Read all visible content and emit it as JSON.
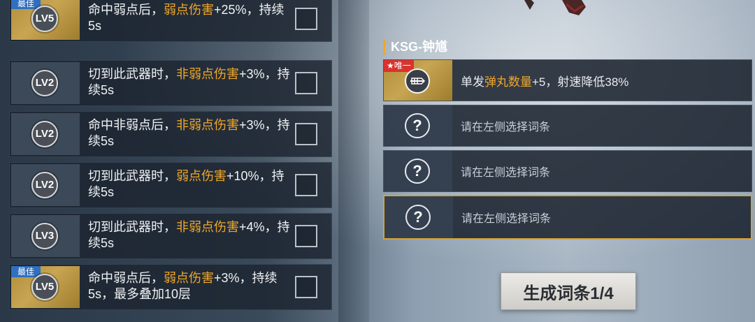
{
  "left_list": [
    {
      "level": "LV5",
      "best": true,
      "best_label": "最佳",
      "text_parts": [
        {
          "t": "命中弱点后，",
          "hl": false
        },
        {
          "t": "弱点伤害",
          "hl": true
        },
        {
          "t": "+25%，持续5s",
          "hl": false
        }
      ]
    },
    {
      "level": "LV2",
      "best": false,
      "best_label": "",
      "text_parts": [
        {
          "t": "切到此武器时，",
          "hl": false
        },
        {
          "t": "非弱点伤害",
          "hl": true
        },
        {
          "t": "+3%，持续5s",
          "hl": false
        }
      ]
    },
    {
      "level": "LV2",
      "best": false,
      "best_label": "",
      "text_parts": [
        {
          "t": "命中非弱点后，",
          "hl": false
        },
        {
          "t": "非弱点伤害",
          "hl": true
        },
        {
          "t": "+3%，持续5s",
          "hl": false
        }
      ]
    },
    {
      "level": "LV2",
      "best": false,
      "best_label": "",
      "text_parts": [
        {
          "t": "切到此武器时，",
          "hl": false
        },
        {
          "t": "弱点伤害",
          "hl": true
        },
        {
          "t": "+10%，持续5s",
          "hl": false
        }
      ]
    },
    {
      "level": "LV3",
      "best": false,
      "best_label": "",
      "text_parts": [
        {
          "t": "切到此武器时，",
          "hl": false
        },
        {
          "t": "非弱点伤害",
          "hl": true
        },
        {
          "t": "+4%，持续5s",
          "hl": false
        }
      ]
    },
    {
      "level": "LV5",
      "best": true,
      "best_label": "最佳",
      "text_parts": [
        {
          "t": "命中弱点后，",
          "hl": false
        },
        {
          "t": "弱点伤害",
          "hl": true
        },
        {
          "t": "+3%，持续5s，最多叠加10层",
          "hl": false
        }
      ]
    }
  ],
  "weapon": {
    "title": "KSG-钟馗"
  },
  "slots": [
    {
      "unique": true,
      "unique_label": "★唯一",
      "icon": "ammo-icon",
      "text_parts": [
        {
          "t": "单发",
          "hl": false
        },
        {
          "t": "弹丸数量",
          "hl": true
        },
        {
          "t": "+5，射速降低38%",
          "hl": false
        }
      ]
    },
    {
      "unique": false,
      "icon": "question-icon",
      "placeholder": "请在左侧选择词条"
    },
    {
      "unique": false,
      "icon": "question-icon",
      "placeholder": "请在左侧选择词条"
    },
    {
      "unique": false,
      "icon": "question-icon",
      "placeholder": "请在左侧选择词条",
      "selected": true
    }
  ],
  "question_glyph": "?",
  "generate_button": "生成词条1/4",
  "colors": {
    "highlight": "#f0a72a",
    "gold": "#c7a552",
    "selected_border": "#d2a43b",
    "best_badge": "#2f6fbf",
    "unique_badge": "#d9332e"
  }
}
